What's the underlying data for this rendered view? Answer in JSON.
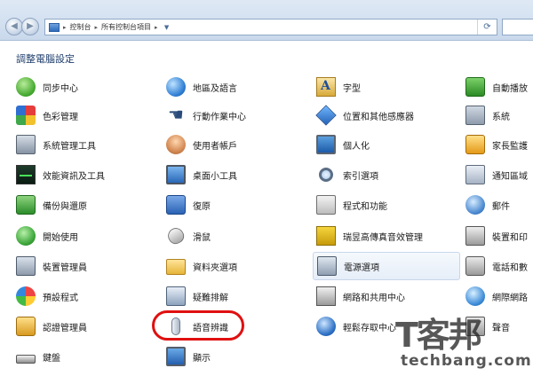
{
  "address_bar": {
    "crumbs": [
      "控制台",
      "所有控制台項目"
    ],
    "separator": "▸"
  },
  "page_title": "調整電腦設定",
  "items": [
    {
      "label": "同步中心",
      "icon": "sync-center-icon"
    },
    {
      "label": "地區及語言",
      "icon": "region-language-icon"
    },
    {
      "label": "字型",
      "icon": "fonts-icon"
    },
    {
      "label": "自動播放",
      "icon": "autoplay-icon"
    },
    {
      "label": "色彩管理",
      "icon": "color-management-icon"
    },
    {
      "label": "行動作業中心",
      "icon": "action-center-icon"
    },
    {
      "label": "位置和其他感應器",
      "icon": "location-sensors-icon"
    },
    {
      "label": "系統",
      "icon": "system-icon"
    },
    {
      "label": "系統管理工具",
      "icon": "admin-tools-icon"
    },
    {
      "label": "使用者帳戶",
      "icon": "user-accounts-icon"
    },
    {
      "label": "個人化",
      "icon": "personalization-icon"
    },
    {
      "label": "家長監護",
      "icon": "parental-controls-icon"
    },
    {
      "label": "效能資訊及工具",
      "icon": "performance-icon"
    },
    {
      "label": "桌面小工具",
      "icon": "desktop-gadgets-icon"
    },
    {
      "label": "索引選項",
      "icon": "indexing-options-icon"
    },
    {
      "label": "通知區域",
      "icon": "notification-area-icon"
    },
    {
      "label": "備份與還原",
      "icon": "backup-restore-icon"
    },
    {
      "label": "復原",
      "icon": "recovery-icon"
    },
    {
      "label": "程式和功能",
      "icon": "programs-features-icon"
    },
    {
      "label": "郵件",
      "icon": "mail-icon"
    },
    {
      "label": "開始使用",
      "icon": "getting-started-icon"
    },
    {
      "label": "滑鼠",
      "icon": "mouse-icon"
    },
    {
      "label": "瑞昱高傳真音效管理",
      "icon": "realtek-audio-icon"
    },
    {
      "label": "裝置和印",
      "icon": "devices-printers-icon"
    },
    {
      "label": "裝置管理員",
      "icon": "device-manager-icon"
    },
    {
      "label": "資料夾選項",
      "icon": "folder-options-icon"
    },
    {
      "label": "電源選項",
      "icon": "power-options-icon"
    },
    {
      "label": "電話和數",
      "icon": "phone-modem-icon"
    },
    {
      "label": "預設程式",
      "icon": "default-programs-icon"
    },
    {
      "label": "疑難排解",
      "icon": "troubleshooting-icon"
    },
    {
      "label": "網路和共用中心",
      "icon": "network-sharing-icon"
    },
    {
      "label": "網際網路",
      "icon": "internet-options-icon"
    },
    {
      "label": "認證管理員",
      "icon": "credential-manager-icon"
    },
    {
      "label": "語音辨識",
      "icon": "speech-recognition-icon"
    },
    {
      "label": "輕鬆存取中心",
      "icon": "ease-of-access-icon"
    },
    {
      "label": "聲音",
      "icon": "sound-icon"
    },
    {
      "label": "鍵盤",
      "icon": "keyboard-icon"
    },
    {
      "label": "顯示",
      "icon": "display-icon"
    }
  ],
  "watermark": {
    "main": "T客邦",
    "sub": "techbang.com"
  }
}
